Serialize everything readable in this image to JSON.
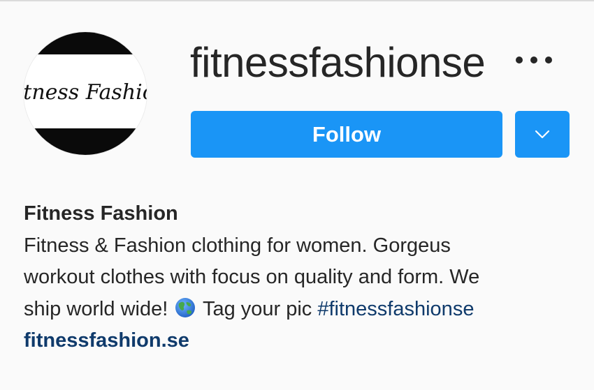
{
  "profile": {
    "username": "fitnessfashionse",
    "avatar_logo_text": "Fitness Fashion",
    "follow_label": "Follow",
    "full_name": "Fitness Fashion",
    "bio": {
      "line1": "Fitness & Fashion clothing for women. Gorgeus",
      "line2": "workout clothes with focus on quality and form. We",
      "line3_before": "ship world wide!",
      "line3_emoji": "globe-asia-australia-icon",
      "line3_after": "Tag your pic",
      "hashtag": "#fitnessfashionse"
    },
    "website": "fitnessfashion.se"
  },
  "colors": {
    "background": "#fafafa",
    "primary_button": "#1a95f6",
    "link": "#0f3a6b",
    "text": "#262626"
  },
  "icons": {
    "more": "more-options-icon",
    "dropdown": "chevron-down-icon"
  }
}
